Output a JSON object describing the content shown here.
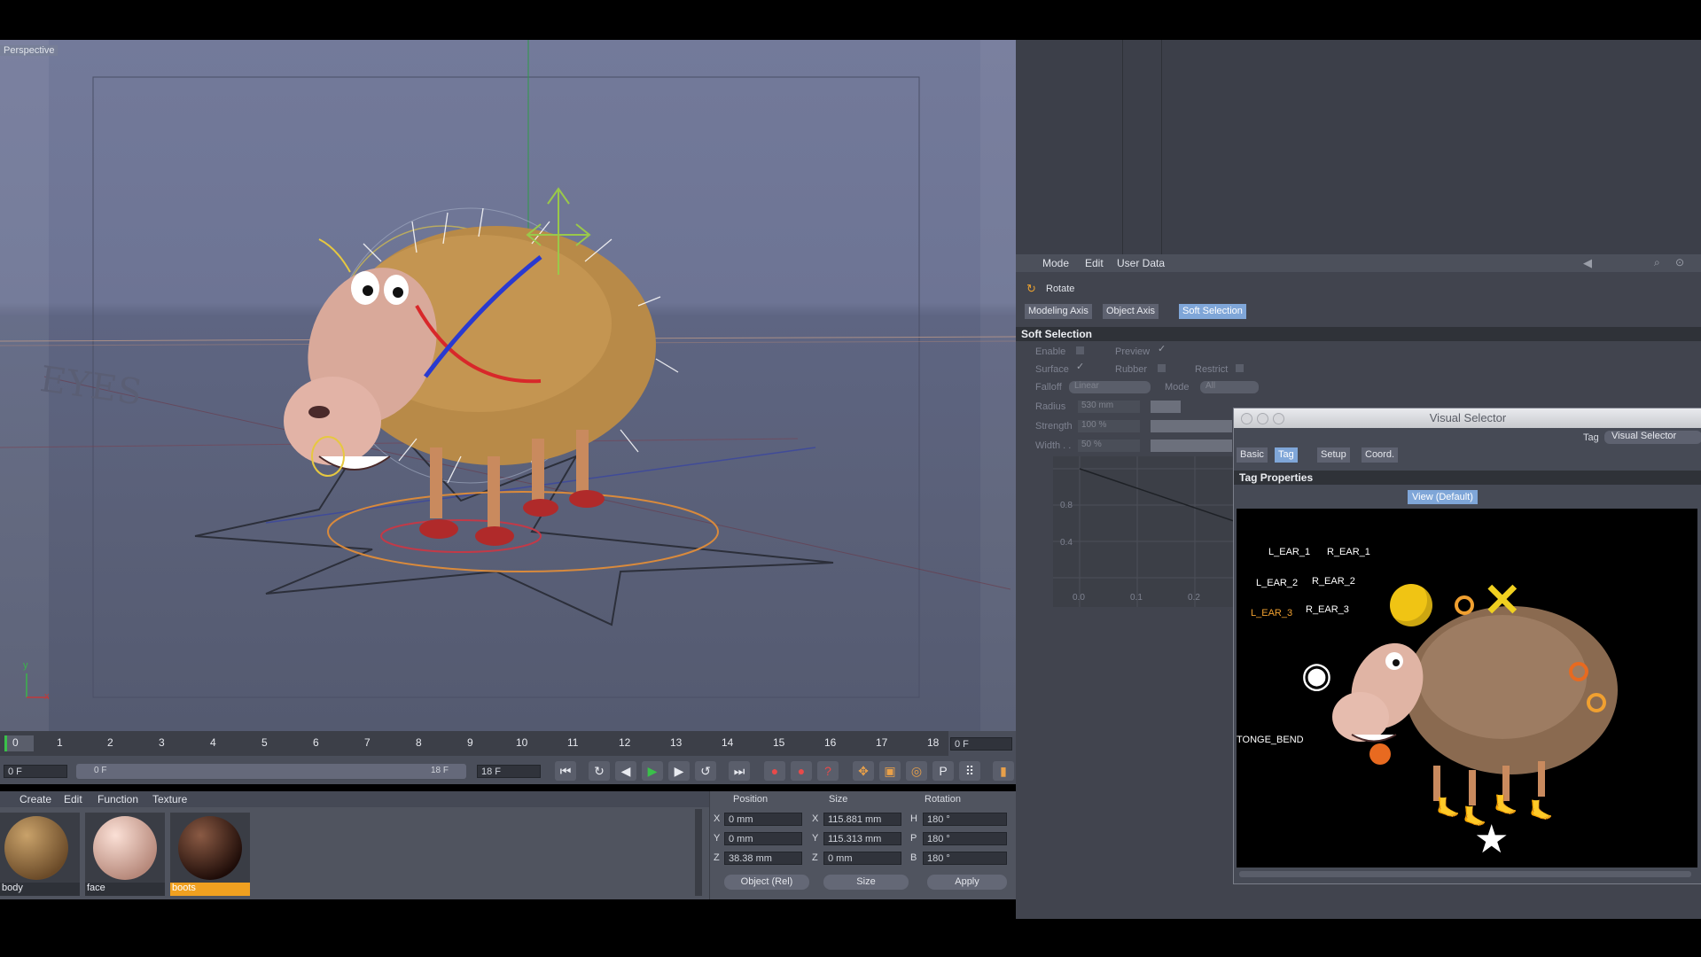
{
  "viewport": {
    "label": "Perspective",
    "eyes_text": "EYES",
    "axis_y": "y",
    "axis_x": "x"
  },
  "timeline": {
    "ruler": [
      "0",
      "1",
      "2",
      "3",
      "4",
      "5",
      "6",
      "7",
      "8",
      "9",
      "10",
      "11",
      "12",
      "13",
      "14",
      "15",
      "16",
      "17",
      "18"
    ],
    "current_frame": "0 F",
    "start_field": "0 F",
    "range_start": "0 F",
    "range_end": "18 F",
    "end_field": "18 F"
  },
  "materials": {
    "menu": [
      "Create",
      "Edit",
      "Function",
      "Texture"
    ],
    "items": [
      {
        "label": "body",
        "color": "#a07a45",
        "selected": false
      },
      {
        "label": "face",
        "color": "#e4b8a8",
        "selected": false
      },
      {
        "label": "boots",
        "color": "#3a1a12",
        "selected": true
      }
    ]
  },
  "coords": {
    "headers": {
      "position": "Position",
      "size": "Size",
      "rotation": "Rotation"
    },
    "rows": [
      {
        "axis": "X",
        "pos": "0 mm",
        "size_axis": "X",
        "size": "115.881 mm",
        "rot_axis": "H",
        "rot": "180 °"
      },
      {
        "axis": "Y",
        "pos": "0 mm",
        "size_axis": "Y",
        "size": "115.313 mm",
        "rot_axis": "P",
        "rot": "180 °"
      },
      {
        "axis": "Z",
        "pos": "38.38 mm",
        "size_axis": "Z",
        "size": "0 mm",
        "rot_axis": "B",
        "rot": "180 °"
      }
    ],
    "mode_select": "Object (Rel)",
    "size_select": "Size",
    "apply": "Apply"
  },
  "attributes": {
    "menu": [
      "Mode",
      "Edit",
      "User Data"
    ],
    "tool_name": "Rotate",
    "tabs": [
      "Modeling Axis",
      "Object Axis",
      "Soft Selection"
    ],
    "active_tab": "Soft Selection",
    "section": "Soft Selection",
    "enable": "Enable",
    "preview": "Preview",
    "surface": "Surface",
    "rubber": "Rubber",
    "restrict": "Restrict",
    "falloff_label": "Falloff",
    "falloff_value": "Linear",
    "mode_label": "Mode",
    "mode_value": "All",
    "radius_label": "Radius",
    "radius_value": "530 mm",
    "strength_label": "Strength",
    "strength_value": "100 %",
    "width_label": "Width . .",
    "width_value": "50 %",
    "graph_y": [
      "0.8",
      "0.4"
    ],
    "graph_x": [
      "0.0",
      "0.1",
      "0.2"
    ]
  },
  "visual_selector": {
    "title": "Visual Selector",
    "tag_label": "Tag",
    "tag_value": "Visual Selector",
    "tabs": [
      "Basic",
      "Tag",
      "Setup",
      "Coord."
    ],
    "active_tab": "Tag",
    "section": "Tag Properties",
    "view_button": "View (Default)",
    "parts": {
      "l_ear_1": "L_EAR_1",
      "r_ear_1": "R_EAR_1",
      "l_ear_2": "L_EAR_2",
      "r_ear_2": "R_EAR_2",
      "l_ear_3": "L_EAR_3",
      "r_ear_3": "R_EAR_3",
      "tonge": "TONGE_BEND"
    }
  }
}
